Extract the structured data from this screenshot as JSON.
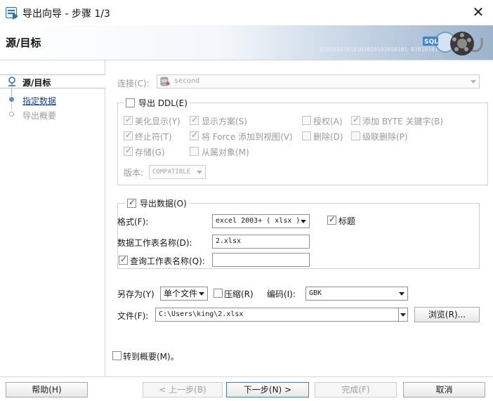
{
  "window": {
    "title": "导出向导 - 步骤 1/3",
    "close_symbol": "✕"
  },
  "banner": {
    "title": "源/目标",
    "binary_text": "01010101010101010101010101 01010101010",
    "graphic_label": "SQL"
  },
  "nav": {
    "items": [
      {
        "label": "源/目标",
        "state": "current"
      },
      {
        "label": "指定数据",
        "state": "link"
      },
      {
        "label": "导出概要",
        "state": "disabled"
      }
    ]
  },
  "connection": {
    "label": "连接(C):",
    "value": "second"
  },
  "ddl": {
    "title": "导出 DDL(E)",
    "checked": false,
    "options": [
      {
        "label": "美化显示(Y)",
        "checked": true
      },
      {
        "label": "显示方案(S)",
        "checked": true
      },
      {
        "label": "授权(A)",
        "checked": false
      },
      {
        "label": "添加 BYTE 关键字(B)",
        "checked": true
      },
      {
        "label": "终止符(T)",
        "checked": true
      },
      {
        "label": "将 Force 添加到视图(V)",
        "checked": true
      },
      {
        "label": "删除(D)",
        "checked": false
      },
      {
        "label": "级联删除(P)",
        "checked": false
      },
      {
        "label": "存储(G)",
        "checked": true
      },
      {
        "label": "从属对象(M)",
        "checked": false
      }
    ],
    "version_label": "版本:",
    "version_value": "COMPATIBLE"
  },
  "export_data": {
    "title": "导出数据(O)",
    "checked": true,
    "format_label": "格式(F):",
    "format_value": "excel 2003+ ( xlsx )",
    "header_label": "标题",
    "header_checked": true,
    "sheet_name_label": "数据工作表名称(D):",
    "sheet_name_value": "2.xlsx",
    "query_sheet_label": "查询工作表名称(Q):",
    "query_sheet_checked": true,
    "query_sheet_value": ""
  },
  "save_as": {
    "label": "另存为(Y)",
    "value": "单个文件",
    "compress_label": "压缩(R)",
    "compress_checked": false,
    "encoding_label": "编码(I):",
    "encoding_value": "GBK"
  },
  "file": {
    "label": "文件(F):",
    "value": "C:\\Users\\king\\2.xlsx",
    "browse_label": "浏览(R)..."
  },
  "goto_summary": {
    "label": "转到概要(M)。",
    "checked": false
  },
  "buttons": {
    "help": "帮助(H)",
    "back": "< 上一步(B)",
    "next": "下一步(N) >",
    "finish": "完成(F)",
    "cancel": "取消"
  },
  "colors": {
    "accent": "#1f4f9c",
    "link": "#1a3f9c",
    "disabled": "#9a9a9a"
  }
}
